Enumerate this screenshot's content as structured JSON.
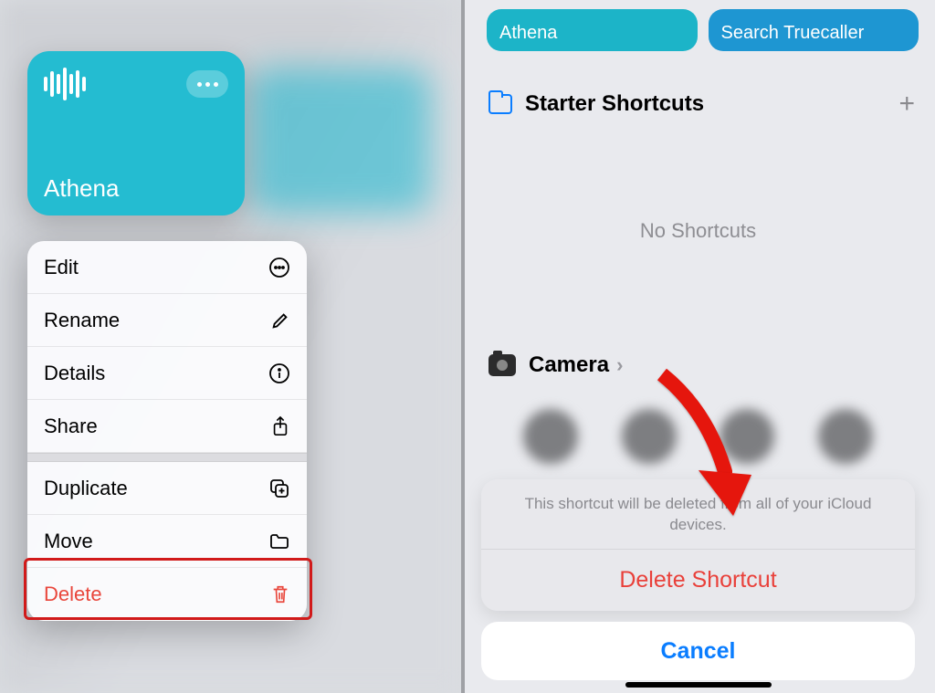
{
  "left": {
    "shortcut": {
      "name": "Athena"
    },
    "menu": {
      "edit": "Edit",
      "rename": "Rename",
      "details": "Details",
      "share": "Share",
      "duplicate": "Duplicate",
      "move": "Move",
      "delete": "Delete"
    }
  },
  "right": {
    "chips": {
      "athena": "Athena",
      "search": "Search Truecaller"
    },
    "folder": {
      "title": "Starter Shortcuts"
    },
    "empty": "No Shortcuts",
    "camera": "Camera",
    "sheet": {
      "message": "This shortcut will be deleted from all of your iCloud devices.",
      "delete": "Delete Shortcut",
      "cancel": "Cancel"
    }
  },
  "colors": {
    "accent_teal": "#24bcd1",
    "accent_blue": "#0a7dff",
    "danger": "#e9463b"
  }
}
